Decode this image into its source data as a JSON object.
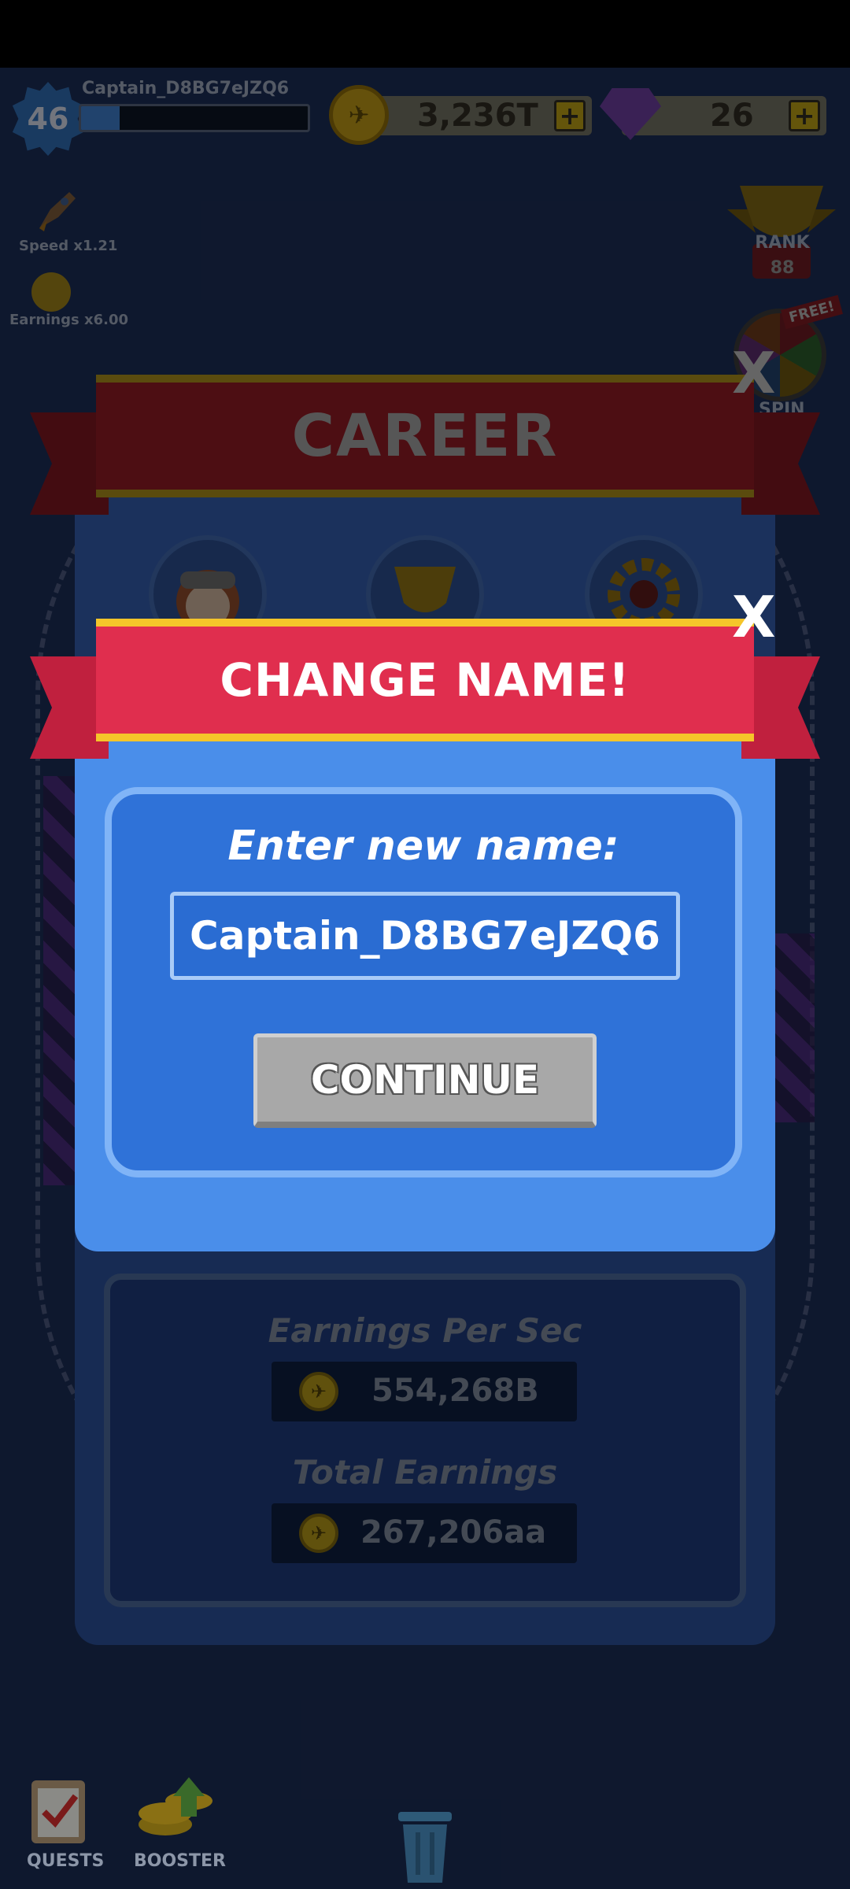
{
  "hud": {
    "level": "46",
    "player_name": "Captain_D8BG7eJZQ6",
    "xp_progress": 0.17,
    "coins": "3,236T",
    "gems": "26",
    "plus": "+"
  },
  "boosts": {
    "speed_label": "Speed x1.21",
    "earnings_label": "Earnings x6.00"
  },
  "right_menu": {
    "rank_label": "RANK",
    "rank_value": "88",
    "free_badge": "FREE!",
    "spin_label": "SPIN"
  },
  "career": {
    "title": "CAREER",
    "close": "X",
    "earnings_per_sec_label": "Earnings Per Sec",
    "earnings_per_sec_value": "554,268B",
    "total_earnings_label": "Total Earnings",
    "total_earnings_value": "267,206aa"
  },
  "change_name": {
    "title": "CHANGE NAME!",
    "close": "X",
    "prompt": "Enter new name:",
    "input_value": "Captain_D8BG7eJZQ6",
    "continue_label": "CONTINUE"
  },
  "bottom_nav": {
    "quests_label": "QUESTS",
    "booster_label": "BOOSTER"
  },
  "colors": {
    "modal_blue": "#4a8eea",
    "ribbon_red": "#e02e4e",
    "ribbon_gold": "#f5c52a"
  }
}
